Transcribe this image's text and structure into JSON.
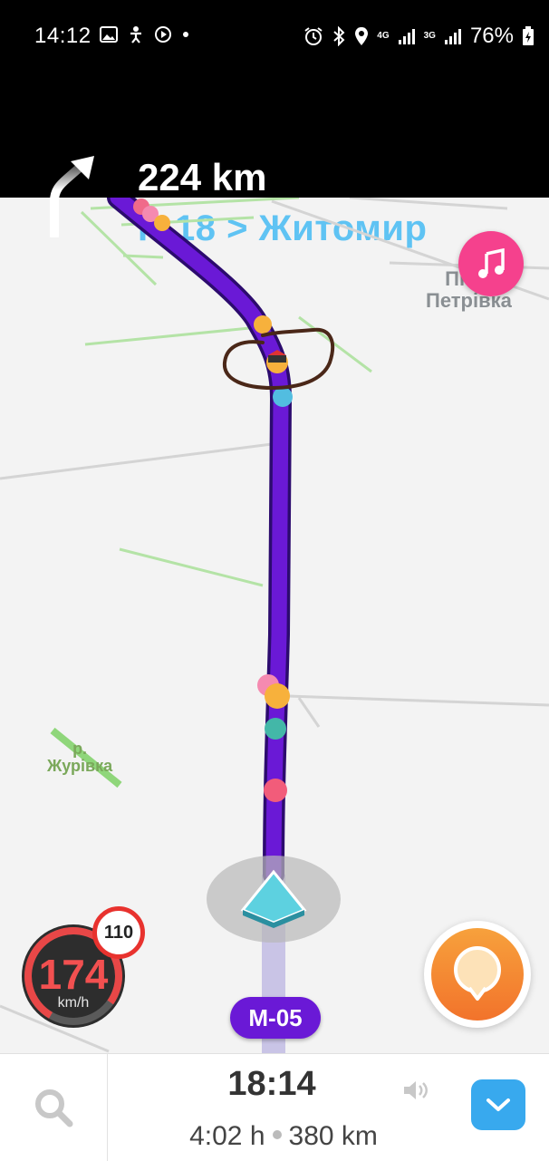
{
  "status_bar": {
    "time": "14:12",
    "net1": "4G",
    "net2": "3G",
    "battery_percent": "76%"
  },
  "navigation": {
    "distance": "224 km",
    "street": "Р-18 > Житомир",
    "turn_icon": "turn-right-arrow-icon"
  },
  "map": {
    "place_label": "Пі     \nПетрівка",
    "river_label": "р.\nЖурівка",
    "road_badge": "М-05",
    "colors": {
      "route": "#6a19d6",
      "road_badge": "#6a19d6",
      "music": "#f5418d"
    }
  },
  "speed": {
    "current": "174",
    "unit": "km/h",
    "limit": "110"
  },
  "bottom_bar": {
    "eta": "18:14",
    "duration": "4:02 h",
    "remaining": "380 km"
  }
}
